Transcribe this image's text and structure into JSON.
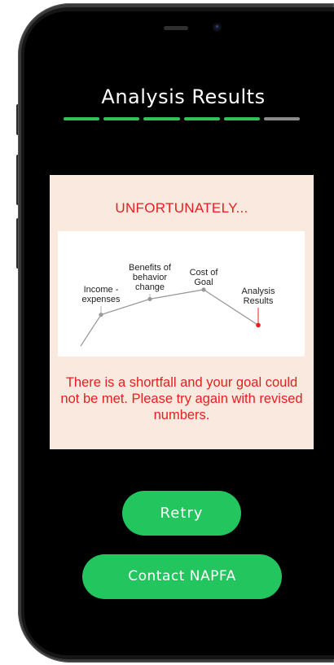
{
  "header": {
    "title": "Analysis Results",
    "progress": {
      "completed": 5,
      "total": 6
    }
  },
  "card": {
    "heading": "UNFORTUNATELY...",
    "message": "There is a shortfall and your goal could not be met. Please try again with revised numbers."
  },
  "chart_data": {
    "type": "line",
    "categories": [
      "Income - expenses",
      "Benefits of behavior change",
      "Cost of Goal",
      "Analysis Results"
    ],
    "annotations": [
      "Income -\nexpenses",
      "Benefits of\nbehavior\nchange",
      "Cost of\nGoal",
      "Analysis\nResults"
    ],
    "values": [
      0.2,
      0.35,
      0.44,
      0.1
    ],
    "start_value": -0.1,
    "title": "",
    "xlabel": "",
    "ylabel": "",
    "ylim": [
      -0.2,
      1.0
    ],
    "grid": false,
    "point_color": "#9a9a9a",
    "final_point_color": "#e41f1f",
    "line_color": "#9a9a9a"
  },
  "buttons": {
    "retry": "Retry",
    "contact": "Contact NAPFA"
  },
  "colors": {
    "accent_green": "#22c55e",
    "alert_red": "#e41f1f",
    "card_bg": "#f9e9df"
  }
}
